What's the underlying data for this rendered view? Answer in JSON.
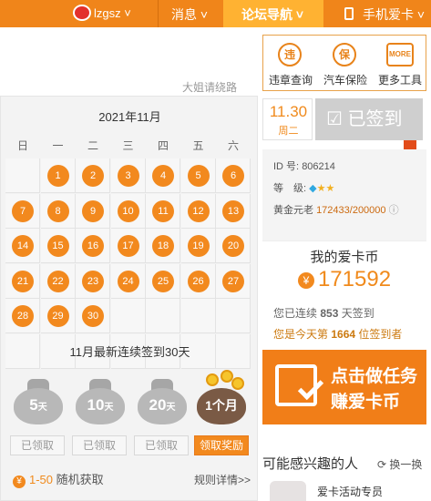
{
  "topbar": {
    "username": "lzgsz",
    "nav_messages": "消息",
    "nav_forum": "论坛导航",
    "nav_phone": "手机爱卡"
  },
  "skip_text": "大姐请绕路",
  "calendar": {
    "month_label": "2021年11月",
    "weekdays": [
      "日",
      "一",
      "二",
      "三",
      "四",
      "五",
      "六"
    ],
    "days": [
      "1",
      "2",
      "3",
      "4",
      "5",
      "6",
      "7",
      "8",
      "9",
      "10",
      "11",
      "12",
      "13",
      "14",
      "15",
      "16",
      "17",
      "18",
      "19",
      "20",
      "21",
      "22",
      "23",
      "24",
      "25",
      "26",
      "27",
      "28",
      "29",
      "30"
    ],
    "first_weekday_index": 1,
    "streak_text": "11月最新连续签到30天"
  },
  "rewards": [
    {
      "label": "5",
      "unit": "天",
      "button": "已领取"
    },
    {
      "label": "10",
      "unit": "天",
      "button": "已领取"
    },
    {
      "label": "20",
      "unit": "天",
      "button": "已领取"
    },
    {
      "label": "1个月",
      "unit": "",
      "button": "领取奖励"
    }
  ],
  "footer": {
    "range": "1-50",
    "random": "随机获取",
    "rules": "规则详情>>"
  },
  "tools": [
    {
      "icon": "违",
      "label": "违章查询"
    },
    {
      "icon": "保",
      "label": "汽车保险"
    },
    {
      "icon": "MORE",
      "label": "更多工具"
    }
  ],
  "date": {
    "day": "11.30",
    "weekday": "周二"
  },
  "signed_label": "已签到",
  "profile": {
    "id_label": "ID 号:",
    "id_value": "806214",
    "grade_label": "等　级:",
    "gold_label": "黄金元老",
    "gold_value": "172433/200000"
  },
  "coins": {
    "heading": "我的爱卡币",
    "value": "171592",
    "streak_prefix": "您已连续",
    "streak_days": "853",
    "streak_suffix": "天签到",
    "rank_prefix": "您是今天第",
    "rank_value": "1664",
    "rank_suffix": "位签到者"
  },
  "banner": {
    "line1": "点击做任务",
    "line2": "赚爱卡币"
  },
  "interest": {
    "title": "可能感兴趣的人",
    "swap": "换一换",
    "promo": "爱卡活动专员"
  }
}
